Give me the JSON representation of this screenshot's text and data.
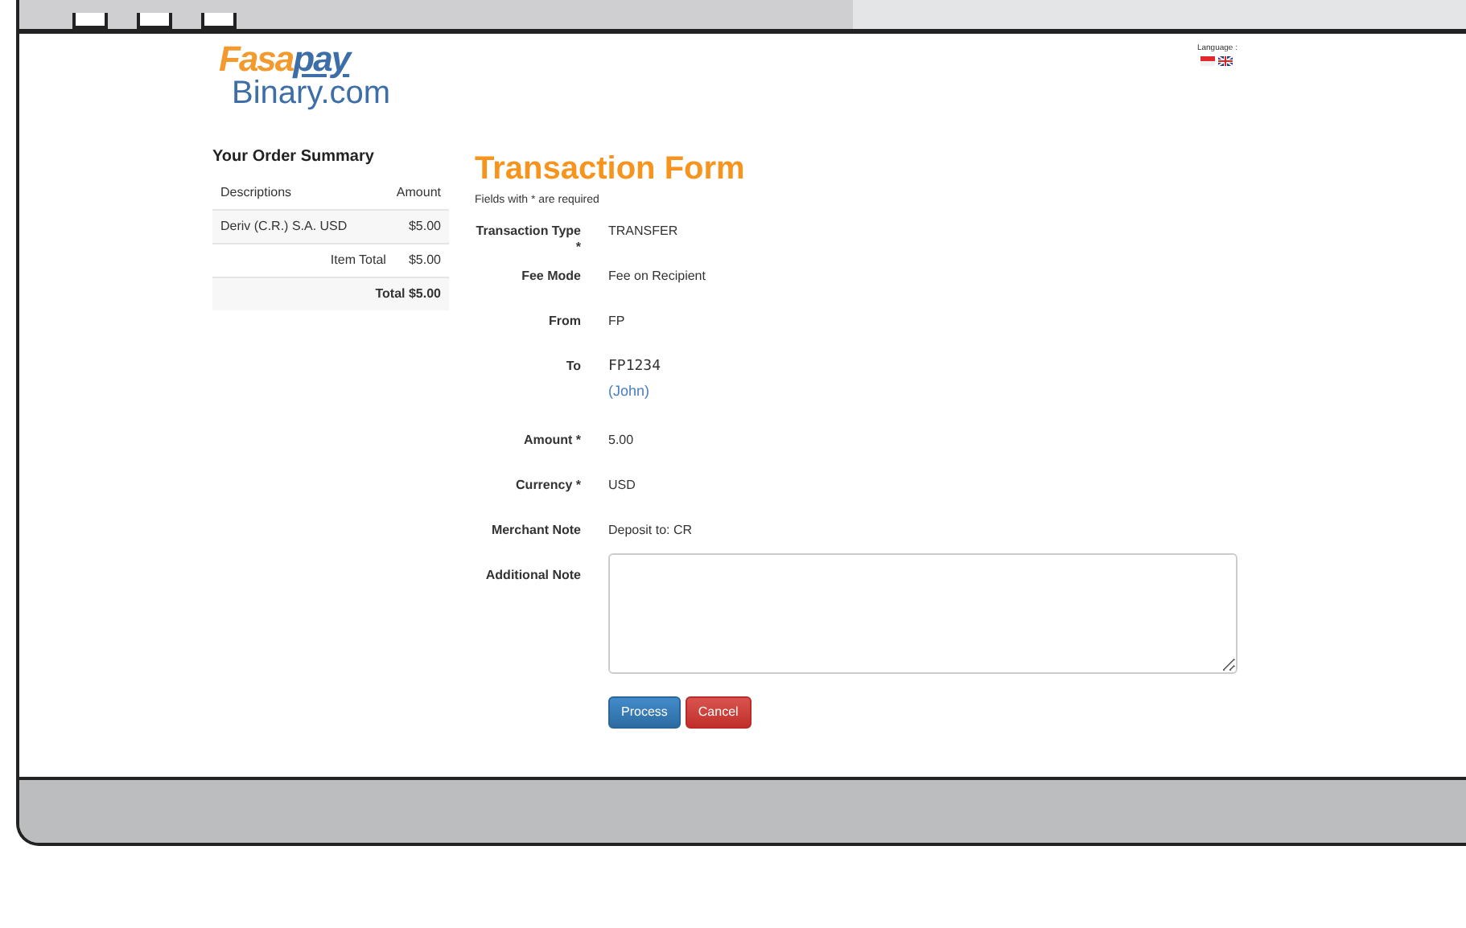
{
  "logo": {
    "brand_1": "Fasa",
    "brand_2": "pay",
    "site": "Binary.com"
  },
  "language": {
    "label": "Language :",
    "flags": [
      {
        "kind": "indonesia"
      },
      {
        "kind": "uk"
      }
    ]
  },
  "order_summary": {
    "title": "Your Order Summary",
    "columns": [
      "Descriptions",
      "Amount"
    ],
    "rows": [
      {
        "kind": "item",
        "label": "Deriv (C.R.) S.A. USD",
        "amount": "$5.00"
      },
      {
        "kind": "subtotal",
        "label": "Item Total",
        "amount": "$5.00"
      },
      {
        "kind": "total",
        "label": "Total $5.00"
      }
    ]
  },
  "form": {
    "title": "Transaction Form",
    "note": "Fields with * are required",
    "fields": [
      {
        "kind": "text",
        "label": "Transaction Type *",
        "value": "TRANSFER"
      },
      {
        "kind": "text",
        "label": "Fee Mode",
        "value": "Fee on Recipient"
      },
      {
        "kind": "text",
        "label": "From",
        "value": "FP"
      },
      {
        "kind": "recipient",
        "label": "To",
        "value": "FP1234",
        "name": "(John)"
      },
      {
        "kind": "text",
        "label": "Amount *",
        "value": "5.00"
      },
      {
        "kind": "text",
        "label": "Currency *",
        "value": "USD"
      },
      {
        "kind": "text",
        "label": "Merchant Note",
        "value": "Deposit to: CR"
      },
      {
        "kind": "textarea",
        "label": "Additional Note"
      }
    ],
    "buttons": [
      {
        "kind": "primary",
        "label": "Process"
      },
      {
        "kind": "danger",
        "label": "Cancel"
      }
    ]
  }
}
